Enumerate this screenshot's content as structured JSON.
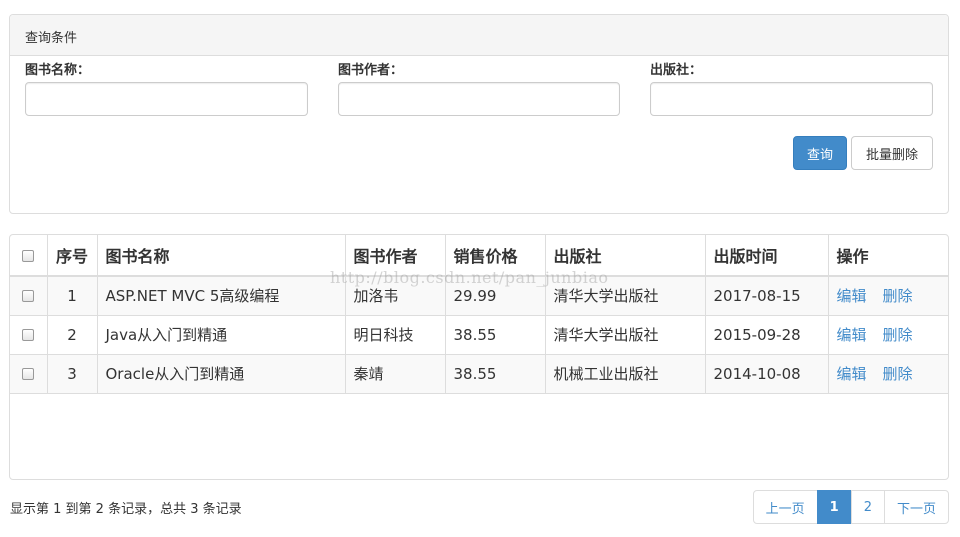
{
  "query_panel": {
    "title": "查询条件",
    "fields": [
      {
        "label": "图书名称：",
        "value": "",
        "placeholder": ""
      },
      {
        "label": "图书作者：",
        "value": "",
        "placeholder": ""
      },
      {
        "label": "出版社：",
        "value": "",
        "placeholder": ""
      }
    ],
    "search_label": "查询",
    "batch_delete_label": "批量删除"
  },
  "table": {
    "headers": [
      "序号",
      "图书名称",
      "图书作者",
      "销售价格",
      "出版社",
      "出版时间",
      "操作"
    ],
    "rows": [
      {
        "num": "1",
        "name": "ASP.NET MVC 5高级编程",
        "author": "加洛韦",
        "price": "29.99",
        "publisher": "清华大学出版社",
        "date": "2017-08-15",
        "edit": "编辑",
        "delete": "删除"
      },
      {
        "num": "2",
        "name": "Java从入门到精通",
        "author": "明日科技",
        "price": "38.55",
        "publisher": "清华大学出版社",
        "date": "2015-09-28",
        "edit": "编辑",
        "delete": "删除"
      },
      {
        "num": "3",
        "name": "Oracle从入门到精通",
        "author": "秦靖",
        "price": "38.55",
        "publisher": "机械工业出版社",
        "date": "2014-10-08",
        "edit": "编辑",
        "delete": "删除"
      }
    ]
  },
  "watermark": "http://blog.csdn.net/pan_junbiao",
  "footer": {
    "summary": "显示第 1 到第 2 条记录，总共 3 条记录",
    "pagination": {
      "prev": "上一页",
      "pages": [
        "1",
        "2"
      ],
      "active_page": "1",
      "next": "下一页"
    }
  },
  "colors": {
    "primary": "#428bca",
    "border": "#dddddd",
    "heading_bg": "#f5f5f5"
  }
}
